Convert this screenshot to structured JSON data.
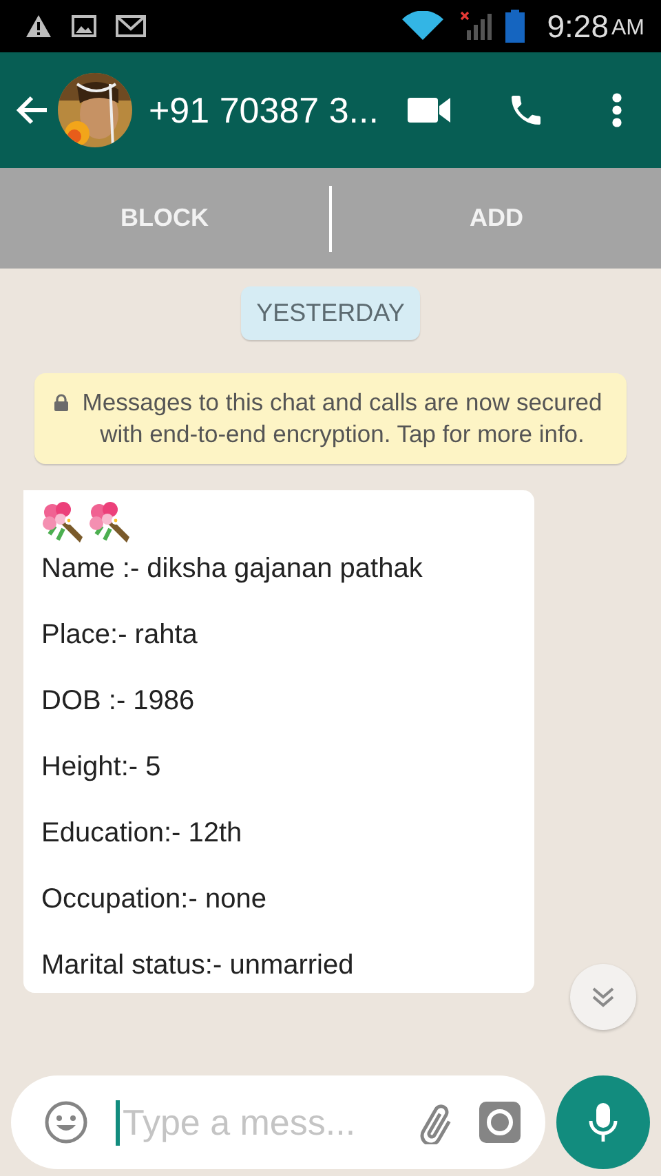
{
  "status_bar": {
    "time": "9:28",
    "ampm": "AM"
  },
  "header": {
    "contact": "+91 70387 3..."
  },
  "actions": [
    "BLOCK",
    "ADD"
  ],
  "date_chip": "YESTERDAY",
  "encryption_notice": "Messages to this chat and calls are now secured with end-to-end encryption. Tap for more info.",
  "message": {
    "lines": [
      "Name :- diksha gajanan pathak",
      "Place:- rahta",
      "DOB :- 1986",
      "Height:- 5",
      "Education:- 12th",
      "Occupation:- none",
      "Marital status:- unmarried"
    ]
  },
  "composer": {
    "placeholder": "Type a mess..."
  }
}
